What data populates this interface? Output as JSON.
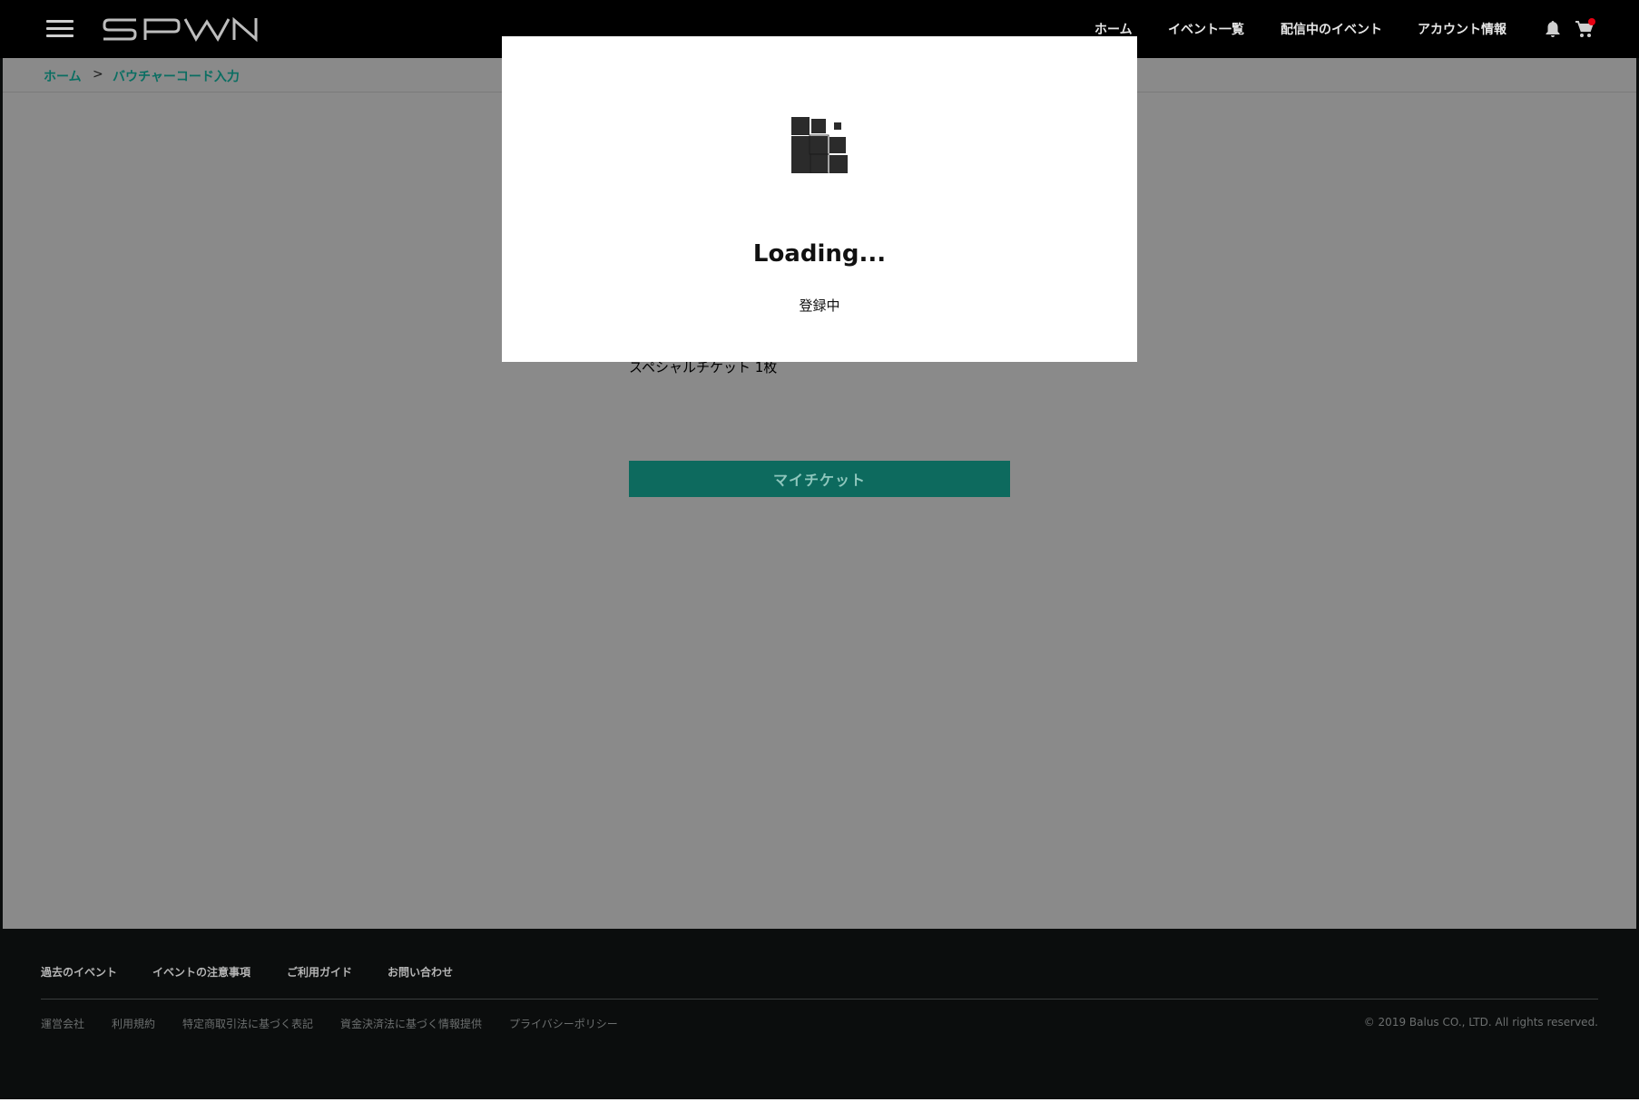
{
  "header": {
    "logo_text": "SPWN",
    "nav": [
      "ホーム",
      "イベント一覧",
      "配信中のイベント",
      "アカウント情報"
    ],
    "icons": [
      "menu-icon",
      "bell-icon",
      "cart-icon"
    ],
    "cart_badge_color": "#e60012"
  },
  "breadcrumb": {
    "items": [
      "ホーム",
      "バウチャーコード入力"
    ],
    "separator": ">"
  },
  "main": {
    "ticket_text": "スペシャルチケット 1枚",
    "my_ticket_button": "マイチケット",
    "accent_color": "#0d6a5e"
  },
  "modal": {
    "title": "Loading...",
    "subtitle": "登録中"
  },
  "footer": {
    "primary_links": [
      "過去のイベント",
      "イベントの注意事項",
      "ご利用ガイド",
      "お問い合わせ"
    ],
    "secondary_links": [
      "運営会社",
      "利用規約",
      "特定商取引法に基づく表記",
      "資金決済法に基づく情報提供",
      "プライバシーポリシー"
    ],
    "copyright": "© 2019 Balus CO., LTD. All rights reserved."
  }
}
